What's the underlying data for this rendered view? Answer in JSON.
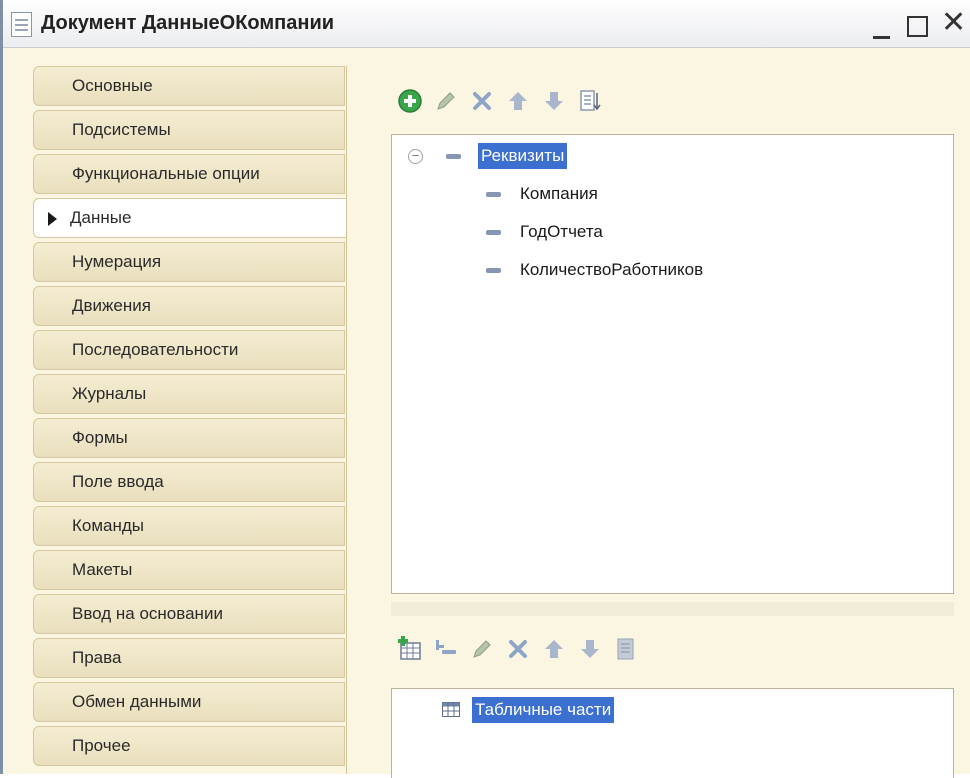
{
  "window": {
    "title": "Документ ДанныеОКомпании",
    "icons": {
      "document": "document-icon",
      "minimize": "minimize-icon",
      "maximize": "maximize-icon",
      "close": "close-icon"
    }
  },
  "tabs": [
    {
      "label": "Основные"
    },
    {
      "label": "Подсистемы"
    },
    {
      "label": "Функциональные опции"
    },
    {
      "label": "Данные",
      "active": true
    },
    {
      "label": "Нумерация"
    },
    {
      "label": "Движения"
    },
    {
      "label": "Последовательности"
    },
    {
      "label": "Журналы"
    },
    {
      "label": "Формы"
    },
    {
      "label": "Поле ввода"
    },
    {
      "label": "Команды"
    },
    {
      "label": "Макеты"
    },
    {
      "label": "Ввод на основании"
    },
    {
      "label": "Права"
    },
    {
      "label": "Обмен данными"
    },
    {
      "label": "Прочее"
    }
  ],
  "attributes": {
    "toolbar": [
      "add-icon",
      "edit-icon",
      "delete-icon",
      "move-up-icon",
      "move-down-icon",
      "sort-icon"
    ],
    "root": {
      "label": "Реквизиты",
      "expanded": true
    },
    "items": [
      "Компания",
      "ГодОтчета",
      "КоличествоРаботников"
    ]
  },
  "tabular_sections": {
    "toolbar": [
      "add-table-icon",
      "add-column-icon",
      "edit-icon",
      "delete-icon",
      "move-up-icon",
      "move-down-icon",
      "sort-icon"
    ],
    "root": {
      "label": "Табличные части"
    }
  },
  "colors": {
    "background": "#fbf6e2",
    "selection": "#3b6fd0",
    "add_green": "#3aa64a",
    "delete_blue": "#8ea5c8"
  }
}
